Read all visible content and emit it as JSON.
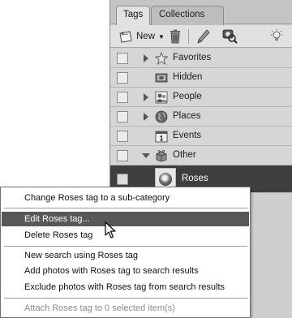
{
  "tabs": [
    {
      "label": "Tags",
      "active": true
    },
    {
      "label": "Collections",
      "active": false
    }
  ],
  "toolbar": {
    "new_label": "New",
    "icons": [
      "new-tag-icon",
      "dropdown-arrow-icon",
      "trash-icon",
      "pencil-icon",
      "find-icon",
      "lightbulb-icon"
    ]
  },
  "tags": [
    {
      "label": "Favorites",
      "icon": "star-icon",
      "expandable": true,
      "expanded": false
    },
    {
      "label": "Hidden",
      "icon": "hidden-icon",
      "expandable": false
    },
    {
      "label": "People",
      "icon": "people-icon",
      "expandable": true,
      "expanded": false
    },
    {
      "label": "Places",
      "icon": "globe-icon",
      "expandable": true,
      "expanded": false
    },
    {
      "label": "Events",
      "icon": "calendar-icon",
      "expandable": false
    },
    {
      "label": "Other",
      "icon": "other-icon",
      "expandable": true,
      "expanded": true
    },
    {
      "label": "Roses",
      "icon": "roses-thumbnail",
      "selected": true
    }
  ],
  "context_menu": {
    "items": [
      {
        "label": "Change Roses tag to a sub-category",
        "state": "normal"
      },
      {
        "label": "Edit Roses tag...",
        "state": "highlighted"
      },
      {
        "label": "Delete Roses tag",
        "state": "normal"
      },
      {
        "label": "New search using Roses tag",
        "state": "normal"
      },
      {
        "label": "Add photos with Roses tag to search results",
        "state": "normal"
      },
      {
        "label": "Exclude photos with Roses tag from search results",
        "state": "normal"
      },
      {
        "label": "Attach Roses tag to 0 selected item(s)",
        "state": "disabled"
      }
    ]
  },
  "colors": {
    "panel_bg": "#cfcfcf",
    "row_bg": "#d6d6d6",
    "selected_row_bg": "#3e3e3e",
    "menu_highlight": "#585858",
    "disabled_text": "#8a8a8a"
  }
}
